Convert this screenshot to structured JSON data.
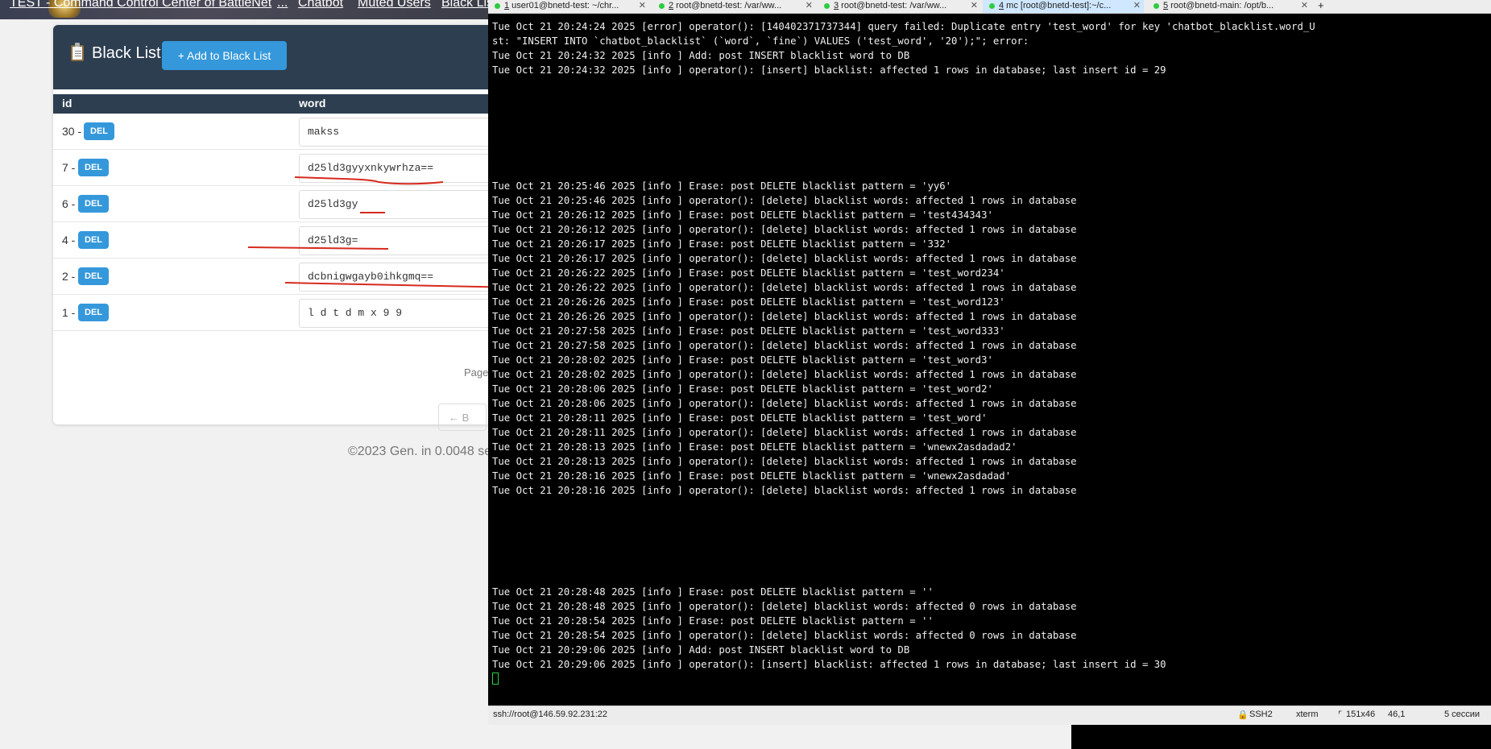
{
  "browser": {
    "nav": [
      "TEST - Command Control Center of BattleNet",
      "...",
      "Chatbot",
      "Muted Users",
      "Black Lis"
    ],
    "card": {
      "title": "Black List",
      "add_button": "+ Add to Black List"
    },
    "table": {
      "headers": [
        "id",
        "word"
      ],
      "rows": [
        {
          "id": "30 -",
          "del": "DEL",
          "word": "makss"
        },
        {
          "id": "7 -",
          "del": "DEL",
          "word": "d25ld3gyyxnkywrhza=="
        },
        {
          "id": "6 -",
          "del": "DEL",
          "word": "d25ld3gy"
        },
        {
          "id": "4 -",
          "del": "DEL",
          "word": "d25ld3g="
        },
        {
          "id": "2 -",
          "del": "DEL",
          "word": "dcbnigwgayb0ihkgmq=="
        },
        {
          "id": "1 -",
          "del": "DEL",
          "word": "l d t d m x 9 9"
        }
      ]
    },
    "pagination_label": "Page",
    "back_button": "← B",
    "footer": "©2023 Gen. in 0.0048 se"
  },
  "terminal": {
    "tabs": [
      {
        "num": "1",
        "label": " user01@bnetd-test: ~/chr..."
      },
      {
        "num": "2",
        "label": " root@bnetd-test: /var/ww..."
      },
      {
        "num": "3",
        "label": " root@bnetd-test: /var/ww..."
      },
      {
        "num": "4",
        "label": " mc [root@bnetd-test]:~/c..."
      },
      {
        "num": "5",
        "label": " root@bnetd-main: /opt/b..."
      }
    ],
    "add_tab": "+",
    "lines": [
      "Tue Oct 21 20:24:24 2025 [error] operator(): [140402371737344] query failed: Duplicate entry 'test_word' for key 'chatbot_blacklist.word_U",
      "st: \"INSERT INTO `chatbot_blacklist` (`word`, `fine`) VALUES ('test_word', '20');\"; error:",
      "Tue Oct 21 20:24:32 2025 [info ] Add: post INSERT blacklist word to DB",
      "Tue Oct 21 20:24:32 2025 [info ] operator(): [insert] blacklist: affected 1 rows in database; last insert id = 29",
      "Tue Oct 21 20:25:46 2025 [info ] Erase: post DELETE blacklist pattern = 'yy6'",
      "Tue Oct 21 20:25:46 2025 [info ] operator(): [delete] blacklist words: affected 1 rows in database",
      "Tue Oct 21 20:26:12 2025 [info ] Erase: post DELETE blacklist pattern = 'test434343'",
      "Tue Oct 21 20:26:12 2025 [info ] operator(): [delete] blacklist words: affected 1 rows in database",
      "Tue Oct 21 20:26:17 2025 [info ] Erase: post DELETE blacklist pattern = '332'",
      "Tue Oct 21 20:26:17 2025 [info ] operator(): [delete] blacklist words: affected 1 rows in database",
      "Tue Oct 21 20:26:22 2025 [info ] Erase: post DELETE blacklist pattern = 'test_word234'",
      "Tue Oct 21 20:26:22 2025 [info ] operator(): [delete] blacklist words: affected 1 rows in database",
      "Tue Oct 21 20:26:26 2025 [info ] Erase: post DELETE blacklist pattern = 'test_word123'",
      "Tue Oct 21 20:26:26 2025 [info ] operator(): [delete] blacklist words: affected 1 rows in database",
      "Tue Oct 21 20:27:58 2025 [info ] Erase: post DELETE blacklist pattern = 'test_word333'",
      "Tue Oct 21 20:27:58 2025 [info ] operator(): [delete] blacklist words: affected 1 rows in database",
      "Tue Oct 21 20:28:02 2025 [info ] Erase: post DELETE blacklist pattern = 'test_word3'",
      "Tue Oct 21 20:28:02 2025 [info ] operator(): [delete] blacklist words: affected 1 rows in database",
      "Tue Oct 21 20:28:06 2025 [info ] Erase: post DELETE blacklist pattern = 'test_word2'",
      "Tue Oct 21 20:28:06 2025 [info ] operator(): [delete] blacklist words: affected 1 rows in database",
      "Tue Oct 21 20:28:11 2025 [info ] Erase: post DELETE blacklist pattern = 'test_word'",
      "Tue Oct 21 20:28:11 2025 [info ] operator(): [delete] blacklist words: affected 1 rows in database",
      "Tue Oct 21 20:28:13 2025 [info ] Erase: post DELETE blacklist pattern = 'wnewx2asdadad2'",
      "Tue Oct 21 20:28:13 2025 [info ] operator(): [delete] blacklist words: affected 1 rows in database",
      "Tue Oct 21 20:28:16 2025 [info ] Erase: post DELETE blacklist pattern = 'wnewx2asdadad'",
      "Tue Oct 21 20:28:16 2025 [info ] operator(): [delete] blacklist words: affected 1 rows in database",
      "Tue Oct 21 20:28:48 2025 [info ] Erase: post DELETE blacklist pattern = ''",
      "Tue Oct 21 20:28:48 2025 [info ] operator(): [delete] blacklist words: affected 0 rows in database",
      "Tue Oct 21 20:28:54 2025 [info ] Erase: post DELETE blacklist pattern = ''",
      "Tue Oct 21 20:28:54 2025 [info ] operator(): [delete] blacklist words: affected 0 rows in database",
      "Tue Oct 21 20:29:06 2025 [info ] Add: post INSERT blacklist word to DB",
      "Tue Oct 21 20:29:06 2025 [info ] operator(): [insert] blacklist: affected 1 rows in database; last insert id = 30"
    ],
    "status": {
      "connection": "ssh://root@146.59.92.231:22",
      "protocol": "SSH2",
      "term_type": "xterm",
      "size": "151x46",
      "cursor_pos": "46,1",
      "sessions": "5 сессии"
    }
  }
}
